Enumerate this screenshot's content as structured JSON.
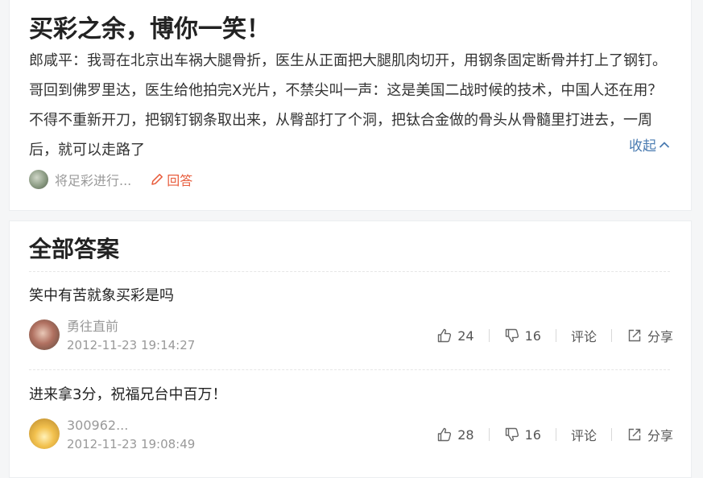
{
  "question": {
    "title": "买彩之余，博你一笑！",
    "body": "郎咸平：我哥在北京出车祸大腿骨折，医生从正面把大腿肌肉切开，用钢条固定断骨并打上了钢钉。哥回到佛罗里达，医生给他拍完X光片，不禁尖叫一声：这是美国二战时候的技术，中国人还在用？不得不重新开刀，把钢钉钢条取出来，从臀部打了个洞，把钛合金做的骨头从骨髓里打进去，一周后，就可以走路了",
    "collapse_label": "收起",
    "asker": "将足彩进行...",
    "reply_label": "回答"
  },
  "answers_section": {
    "title": "全部答案",
    "answers": [
      {
        "text": "笑中有苦就象买彩是吗",
        "author": "勇往直前",
        "time": "2012-11-23 19:14:27",
        "likes": "24",
        "dislikes": "16",
        "comment_label": "评论",
        "share_label": "分享"
      },
      {
        "text": "进来拿3分，祝福兄台中百万！",
        "author": "300962...",
        "time": "2012-11-23 19:08:49",
        "likes": "28",
        "dislikes": "16",
        "comment_label": "评论",
        "share_label": "分享"
      }
    ]
  },
  "colors": {
    "link": "#4a7bb1",
    "reply": "#e85d3d",
    "muted": "#999999"
  }
}
